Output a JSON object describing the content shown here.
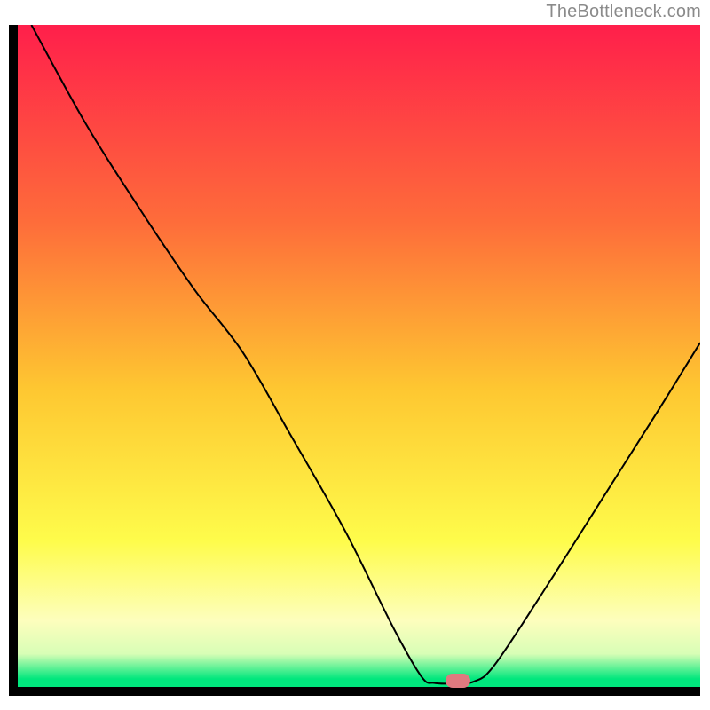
{
  "watermark": "TheBottleneck.com",
  "chart_data": {
    "type": "line",
    "title": "",
    "xlabel": "",
    "ylabel": "",
    "xlim": [
      0,
      100
    ],
    "ylim": [
      0,
      100
    ],
    "grid": false,
    "legend": false,
    "background_gradient_stops": [
      {
        "offset": 0,
        "color": "#ff1f4b"
      },
      {
        "offset": 30,
        "color": "#fe6d3a"
      },
      {
        "offset": 55,
        "color": "#fec731"
      },
      {
        "offset": 78,
        "color": "#fefc4b"
      },
      {
        "offset": 90,
        "color": "#fdfebd"
      },
      {
        "offset": 95,
        "color": "#d8feb6"
      },
      {
        "offset": 98.8,
        "color": "#00e77d"
      },
      {
        "offset": 100,
        "color": "#00e77d"
      }
    ],
    "series": [
      {
        "name": "curve",
        "color": "#000000",
        "stroke_width": 2,
        "x": [
          2.0,
          10.0,
          18.0,
          25.9,
          33.0,
          40.0,
          48.0,
          55.0,
          59.2,
          61.0,
          63.5,
          66.8,
          70.0,
          78.0,
          86.0,
          94.0,
          100.0
        ],
        "y": [
          100.0,
          85.0,
          72.0,
          60.0,
          50.5,
          38.0,
          23.5,
          9.0,
          1.5,
          0.6,
          0.5,
          0.8,
          3.5,
          16.0,
          29.0,
          42.0,
          52.0
        ]
      }
    ],
    "marker": {
      "x": 64.5,
      "y": 1.0,
      "color": "#df7a7f"
    }
  }
}
